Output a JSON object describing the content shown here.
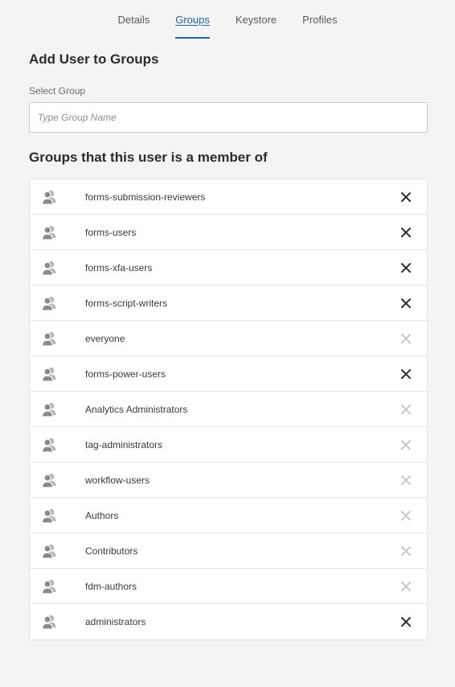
{
  "tabs": [
    {
      "label": "Details",
      "active": false
    },
    {
      "label": "Groups",
      "active": true
    },
    {
      "label": "Keystore",
      "active": false
    },
    {
      "label": "Profiles",
      "active": false
    }
  ],
  "add_section": {
    "title": "Add User to Groups",
    "field_label": "Select Group",
    "placeholder": "Type Group Name",
    "value": ""
  },
  "membership": {
    "title": "Groups that this user is a member of",
    "groups": [
      {
        "name": "forms-submission-reviewers",
        "removable": true,
        "icon": "user-group-icon"
      },
      {
        "name": "forms-users",
        "removable": true,
        "icon": "user-group-icon"
      },
      {
        "name": "forms-xfa-users",
        "removable": true,
        "icon": "user-group-icon"
      },
      {
        "name": "forms-script-writers",
        "removable": true,
        "icon": "user-group-icon"
      },
      {
        "name": "everyone",
        "removable": false,
        "icon": "user-group-icon"
      },
      {
        "name": "forms-power-users",
        "removable": true,
        "icon": "user-group-icon"
      },
      {
        "name": "Analytics Administrators",
        "removable": false,
        "icon": "user-group-icon"
      },
      {
        "name": "tag-administrators",
        "removable": false,
        "icon": "user-group-icon"
      },
      {
        "name": "workflow-users",
        "removable": false,
        "icon": "user-group-icon"
      },
      {
        "name": "Authors",
        "removable": false,
        "icon": "user-group-icon"
      },
      {
        "name": "Contributors",
        "removable": false,
        "icon": "user-group-icon"
      },
      {
        "name": "fdm-authors",
        "removable": false,
        "icon": "user-group-icon"
      },
      {
        "name": "administrators",
        "removable": true,
        "icon": "user-group-icon"
      }
    ]
  },
  "colors": {
    "accent": "#1c62b9",
    "remove_enabled": "#2c2c2c",
    "remove_disabled": "#c8c8c8",
    "icon": "#8a8a8a"
  }
}
